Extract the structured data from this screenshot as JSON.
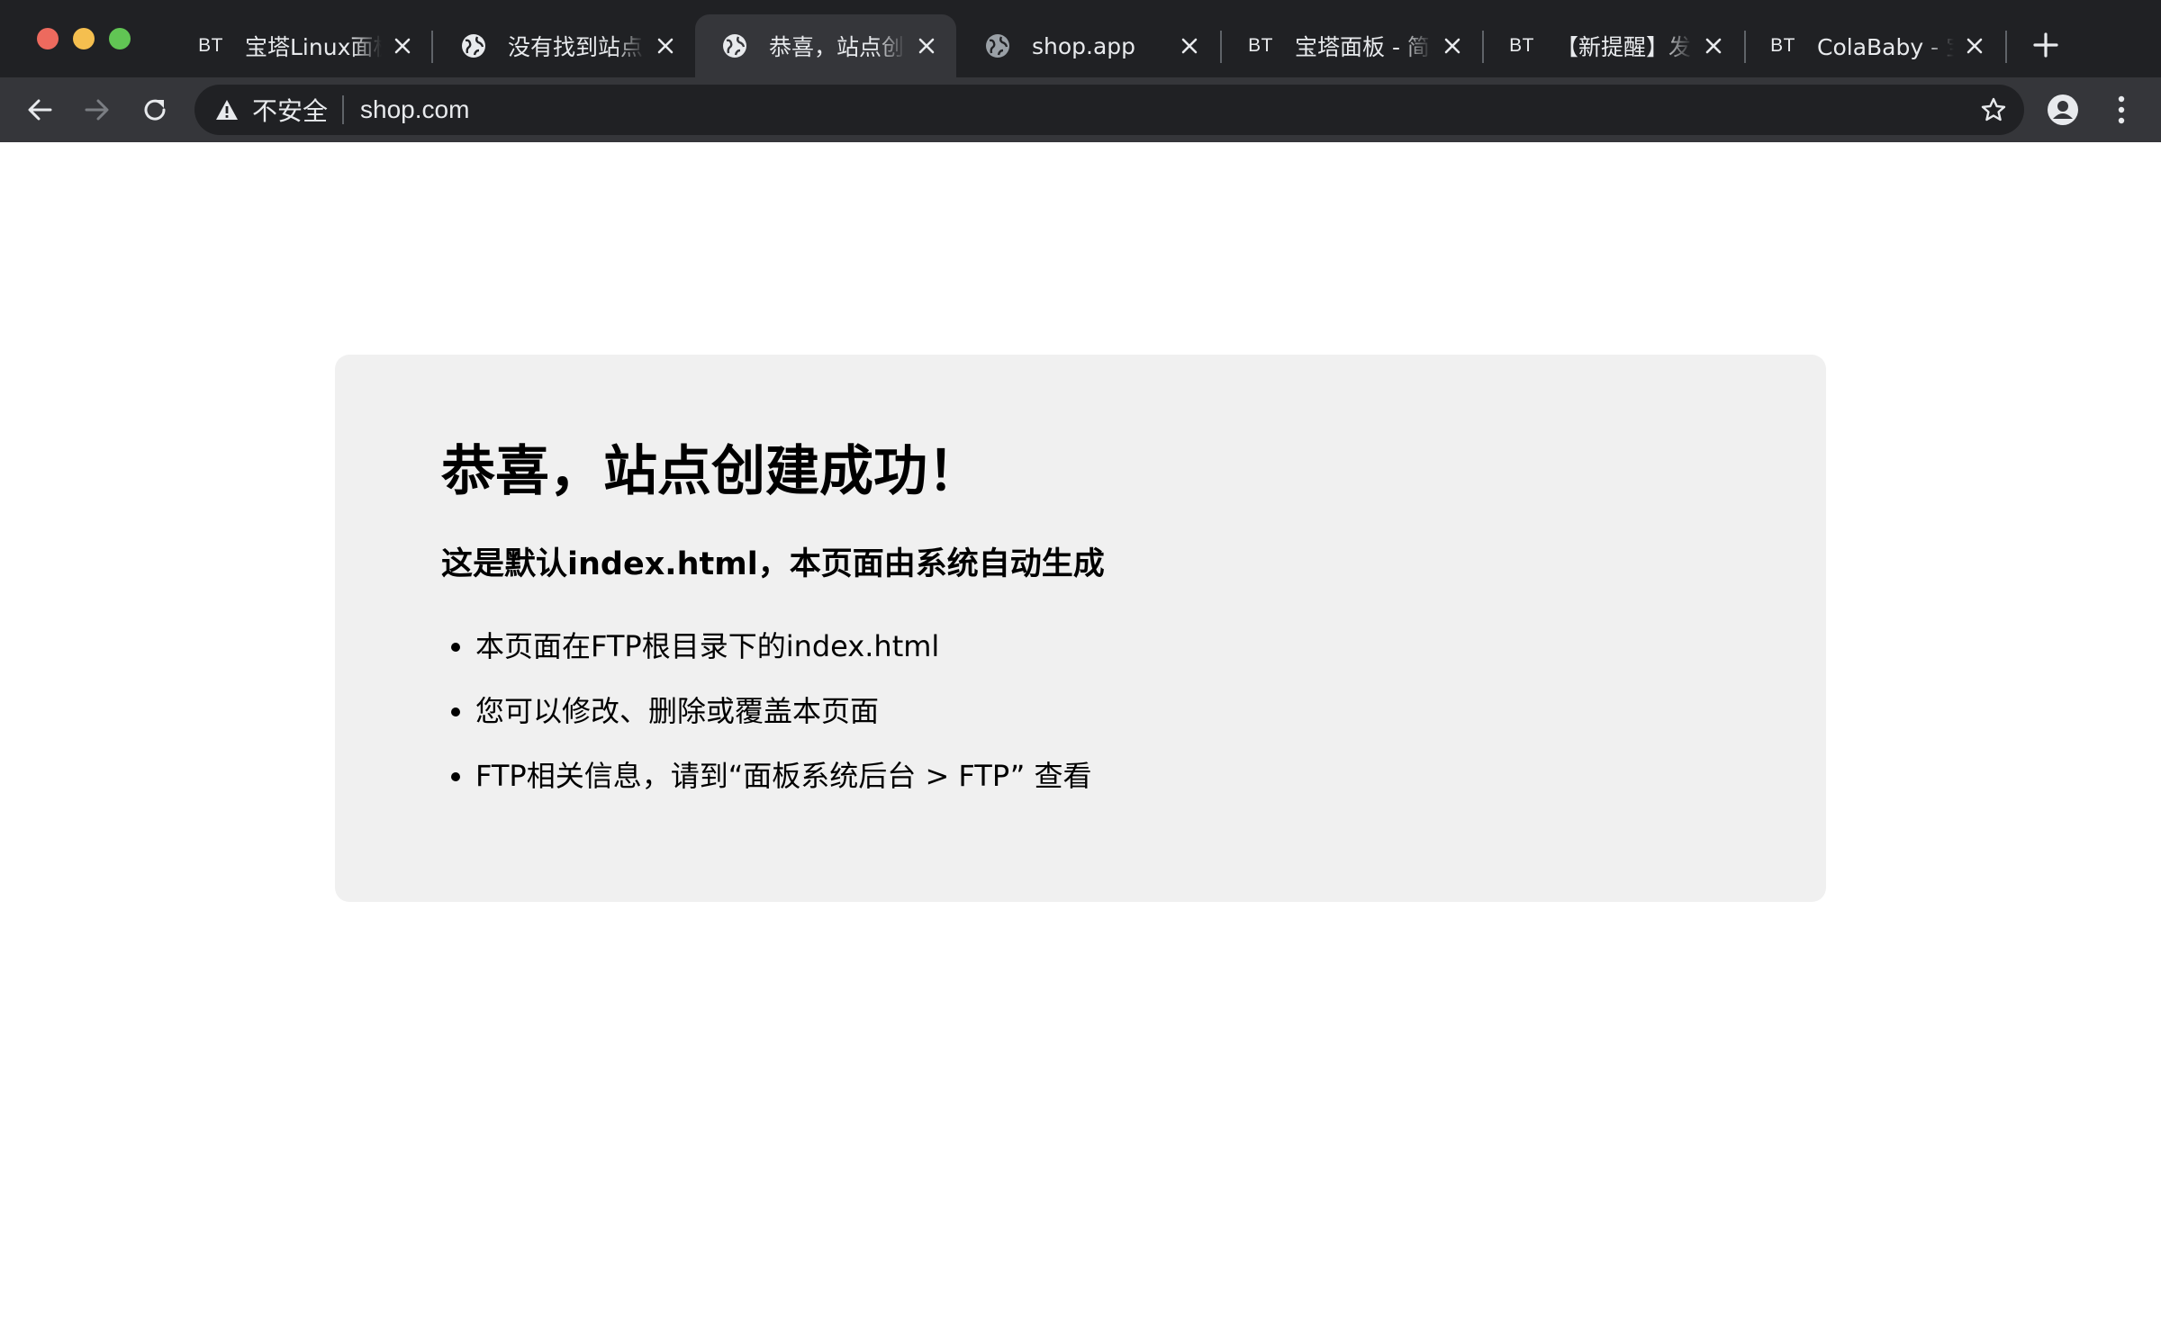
{
  "browser": {
    "tabs": [
      {
        "favicon": "bt-icon",
        "favicon_text": "BT",
        "title": "宝塔Linux面板",
        "active": false
      },
      {
        "favicon": "globe-icon",
        "title": "没有找到站点",
        "active": false
      },
      {
        "favicon": "globe-icon",
        "title": "恭喜，站点创建成功！",
        "active": true
      },
      {
        "favicon": "globe-icon",
        "title": "shop.app",
        "active": false
      },
      {
        "favicon": "bt-icon",
        "favicon_text": "BT",
        "title": "宝塔面板 - 简单好用的Linux/Windows服务器运维管理面板",
        "active": false
      },
      {
        "favicon": "bt-icon",
        "favicon_text": "BT",
        "title": "【新提醒】发表帖子",
        "active": false
      },
      {
        "favicon": "bt-icon",
        "favicon_text": "BT",
        "title": "ColaBaby - 宝塔",
        "active": false
      }
    ],
    "toolbar": {
      "security_label": "不安全",
      "url": "shop.com"
    },
    "icons": {
      "close": "close-icon",
      "new_tab": "plus-icon",
      "back": "arrow-left-icon",
      "forward": "arrow-right-icon",
      "reload": "reload-icon",
      "warning": "warning-triangle-icon",
      "bookmark": "star-icon",
      "profile": "person-icon",
      "menu": "kebab-menu-icon"
    },
    "colors": {
      "tabstrip_bg": "#202124",
      "toolbar_bg": "#35363a",
      "omnibox_bg": "#202124",
      "text": "#e8eaed",
      "card_bg": "#f0f0f0"
    }
  },
  "page": {
    "heading": "恭喜，站点创建成功！",
    "subheading": "这是默认index.html，本页面由系统自动生成",
    "items": [
      "本页面在FTP根目录下的index.html",
      "您可以修改、删除或覆盖本页面",
      "FTP相关信息，请到“面板系统后台 > FTP” 查看"
    ]
  }
}
